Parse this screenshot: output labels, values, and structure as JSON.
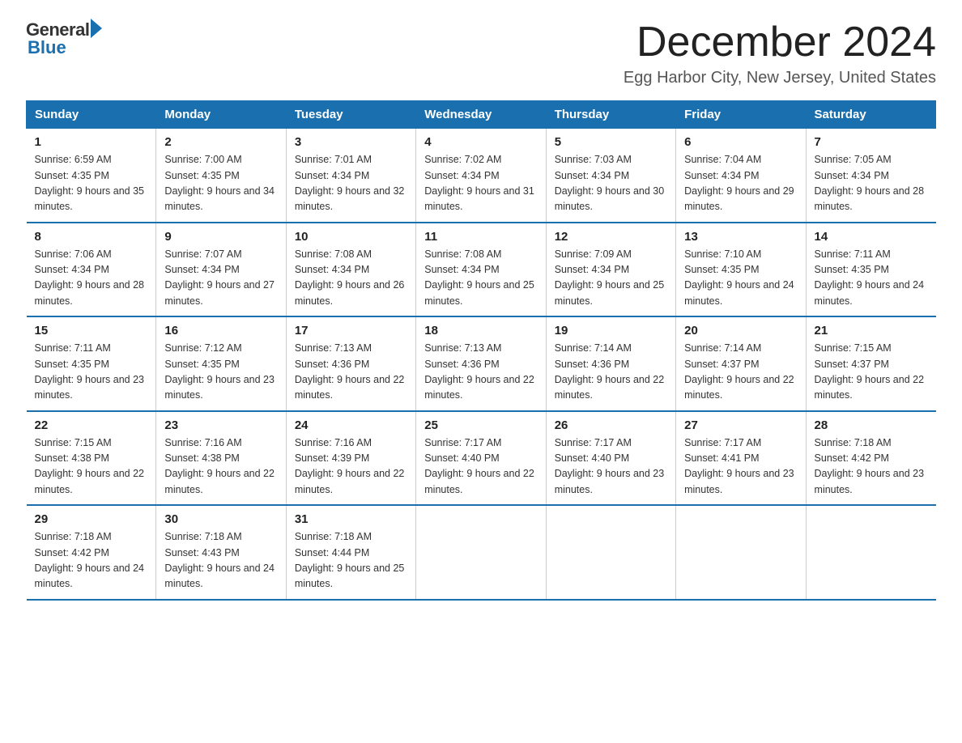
{
  "logo": {
    "general": "General",
    "blue": "Blue"
  },
  "header": {
    "month": "December 2024",
    "location": "Egg Harbor City, New Jersey, United States"
  },
  "weekdays": [
    "Sunday",
    "Monday",
    "Tuesday",
    "Wednesday",
    "Thursday",
    "Friday",
    "Saturday"
  ],
  "weeks": [
    [
      {
        "day": "1",
        "sunrise": "6:59 AM",
        "sunset": "4:35 PM",
        "daylight": "9 hours and 35 minutes."
      },
      {
        "day": "2",
        "sunrise": "7:00 AM",
        "sunset": "4:35 PM",
        "daylight": "9 hours and 34 minutes."
      },
      {
        "day": "3",
        "sunrise": "7:01 AM",
        "sunset": "4:34 PM",
        "daylight": "9 hours and 32 minutes."
      },
      {
        "day": "4",
        "sunrise": "7:02 AM",
        "sunset": "4:34 PM",
        "daylight": "9 hours and 31 minutes."
      },
      {
        "day": "5",
        "sunrise": "7:03 AM",
        "sunset": "4:34 PM",
        "daylight": "9 hours and 30 minutes."
      },
      {
        "day": "6",
        "sunrise": "7:04 AM",
        "sunset": "4:34 PM",
        "daylight": "9 hours and 29 minutes."
      },
      {
        "day": "7",
        "sunrise": "7:05 AM",
        "sunset": "4:34 PM",
        "daylight": "9 hours and 28 minutes."
      }
    ],
    [
      {
        "day": "8",
        "sunrise": "7:06 AM",
        "sunset": "4:34 PM",
        "daylight": "9 hours and 28 minutes."
      },
      {
        "day": "9",
        "sunrise": "7:07 AM",
        "sunset": "4:34 PM",
        "daylight": "9 hours and 27 minutes."
      },
      {
        "day": "10",
        "sunrise": "7:08 AM",
        "sunset": "4:34 PM",
        "daylight": "9 hours and 26 minutes."
      },
      {
        "day": "11",
        "sunrise": "7:08 AM",
        "sunset": "4:34 PM",
        "daylight": "9 hours and 25 minutes."
      },
      {
        "day": "12",
        "sunrise": "7:09 AM",
        "sunset": "4:34 PM",
        "daylight": "9 hours and 25 minutes."
      },
      {
        "day": "13",
        "sunrise": "7:10 AM",
        "sunset": "4:35 PM",
        "daylight": "9 hours and 24 minutes."
      },
      {
        "day": "14",
        "sunrise": "7:11 AM",
        "sunset": "4:35 PM",
        "daylight": "9 hours and 24 minutes."
      }
    ],
    [
      {
        "day": "15",
        "sunrise": "7:11 AM",
        "sunset": "4:35 PM",
        "daylight": "9 hours and 23 minutes."
      },
      {
        "day": "16",
        "sunrise": "7:12 AM",
        "sunset": "4:35 PM",
        "daylight": "9 hours and 23 minutes."
      },
      {
        "day": "17",
        "sunrise": "7:13 AM",
        "sunset": "4:36 PM",
        "daylight": "9 hours and 22 minutes."
      },
      {
        "day": "18",
        "sunrise": "7:13 AM",
        "sunset": "4:36 PM",
        "daylight": "9 hours and 22 minutes."
      },
      {
        "day": "19",
        "sunrise": "7:14 AM",
        "sunset": "4:36 PM",
        "daylight": "9 hours and 22 minutes."
      },
      {
        "day": "20",
        "sunrise": "7:14 AM",
        "sunset": "4:37 PM",
        "daylight": "9 hours and 22 minutes."
      },
      {
        "day": "21",
        "sunrise": "7:15 AM",
        "sunset": "4:37 PM",
        "daylight": "9 hours and 22 minutes."
      }
    ],
    [
      {
        "day": "22",
        "sunrise": "7:15 AM",
        "sunset": "4:38 PM",
        "daylight": "9 hours and 22 minutes."
      },
      {
        "day": "23",
        "sunrise": "7:16 AM",
        "sunset": "4:38 PM",
        "daylight": "9 hours and 22 minutes."
      },
      {
        "day": "24",
        "sunrise": "7:16 AM",
        "sunset": "4:39 PM",
        "daylight": "9 hours and 22 minutes."
      },
      {
        "day": "25",
        "sunrise": "7:17 AM",
        "sunset": "4:40 PM",
        "daylight": "9 hours and 22 minutes."
      },
      {
        "day": "26",
        "sunrise": "7:17 AM",
        "sunset": "4:40 PM",
        "daylight": "9 hours and 23 minutes."
      },
      {
        "day": "27",
        "sunrise": "7:17 AM",
        "sunset": "4:41 PM",
        "daylight": "9 hours and 23 minutes."
      },
      {
        "day": "28",
        "sunrise": "7:18 AM",
        "sunset": "4:42 PM",
        "daylight": "9 hours and 23 minutes."
      }
    ],
    [
      {
        "day": "29",
        "sunrise": "7:18 AM",
        "sunset": "4:42 PM",
        "daylight": "9 hours and 24 minutes."
      },
      {
        "day": "30",
        "sunrise": "7:18 AM",
        "sunset": "4:43 PM",
        "daylight": "9 hours and 24 minutes."
      },
      {
        "day": "31",
        "sunrise": "7:18 AM",
        "sunset": "4:44 PM",
        "daylight": "9 hours and 25 minutes."
      },
      null,
      null,
      null,
      null
    ]
  ]
}
